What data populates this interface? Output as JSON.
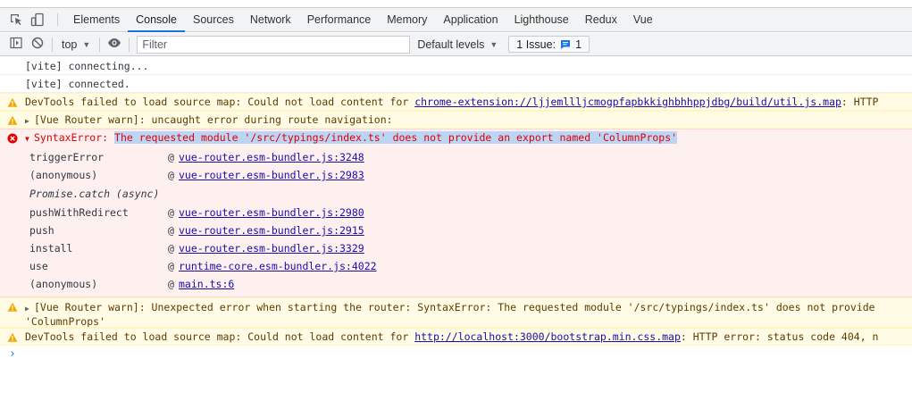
{
  "tabs": [
    "Elements",
    "Console",
    "Sources",
    "Network",
    "Performance",
    "Memory",
    "Application",
    "Lighthouse",
    "Redux",
    "Vue"
  ],
  "active_tab": "Console",
  "toolbar": {
    "context": "top",
    "filter_placeholder": "Filter",
    "levels_label": "Default levels",
    "issues_label": "1 Issue:",
    "issues_count": "1"
  },
  "console": {
    "info1": "[vite] connecting...",
    "info2": "[vite] connected.",
    "warn1": {
      "prefix": "DevTools failed to load source map: Could not load content for ",
      "link": "chrome-extension://ljjemllljcmogpfapbkkighbhhppjdbg/build/util.js.map",
      "suffix": ": HTTP"
    },
    "warn2": "[Vue Router warn]: uncaught error during route navigation:",
    "error": {
      "type": "SyntaxError: ",
      "message": "The requested module '/src/typings/index.ts' does not provide an export named 'ColumnProps'"
    },
    "stack_top": [
      {
        "fn": "triggerError",
        "loc": "vue-router.esm-bundler.js:3248"
      },
      {
        "fn": "(anonymous)",
        "loc": "vue-router.esm-bundler.js:2983"
      }
    ],
    "async_label": "Promise.catch (async)",
    "stack_bottom": [
      {
        "fn": "pushWithRedirect",
        "loc": "vue-router.esm-bundler.js:2980"
      },
      {
        "fn": "push",
        "loc": "vue-router.esm-bundler.js:2915"
      },
      {
        "fn": "install",
        "loc": "vue-router.esm-bundler.js:3329"
      },
      {
        "fn": "use",
        "loc": "runtime-core.esm-bundler.js:4022"
      },
      {
        "fn": "(anonymous)",
        "loc": "main.ts:6"
      }
    ],
    "warn3_line1": "[Vue Router warn]: Unexpected error when starting the router: SyntaxError: The requested module '/src/typings/index.ts' does not provide",
    "warn3_line2": "'ColumnProps'",
    "warn4": {
      "prefix": "DevTools failed to load source map: Could not load content for ",
      "link": "http://localhost:3000/bootstrap.min.css.map",
      "suffix": ": HTTP error: status code 404, n"
    }
  },
  "colors": {
    "warning_bg": "#fffbe5",
    "error_bg": "#fff0f0",
    "error_text": "#e20000",
    "accent": "#1a73e8"
  },
  "icons": [
    "inspect-element-icon",
    "device-toggle-icon",
    "sidebar-toggle-icon",
    "clear-console-icon",
    "eye-icon",
    "issue-message-icon",
    "warning-icon",
    "error-icon",
    "prompt-chevron-icon"
  ]
}
